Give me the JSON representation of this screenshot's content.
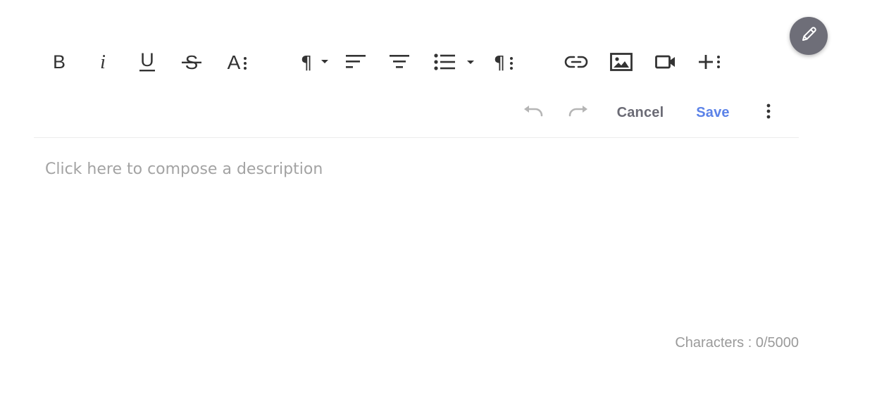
{
  "toolbar": {
    "buttons": [
      {
        "id": "bold",
        "icon": "bold-icon",
        "label": "B"
      },
      {
        "id": "italic",
        "icon": "italic-icon",
        "label": "i"
      },
      {
        "id": "underline",
        "icon": "underline-icon",
        "label": "U"
      },
      {
        "id": "strikethrough",
        "icon": "strikethrough-icon",
        "label": "S"
      },
      {
        "id": "text-style-more",
        "icon": "text-style-more-icon",
        "label": "A"
      },
      {
        "id": "paragraph-format",
        "icon": "paragraph-icon",
        "label": "¶"
      },
      {
        "id": "align-left",
        "icon": "align-left-icon"
      },
      {
        "id": "align-center",
        "icon": "align-center-icon"
      },
      {
        "id": "unordered-list",
        "icon": "bulleted-list-icon"
      },
      {
        "id": "paragraph-more",
        "icon": "paragraph-more-icon",
        "label": "¶"
      },
      {
        "id": "insert-link",
        "icon": "link-icon"
      },
      {
        "id": "insert-image",
        "icon": "image-icon"
      },
      {
        "id": "insert-video",
        "icon": "video-icon"
      },
      {
        "id": "insert-more",
        "icon": "plus-more-icon"
      }
    ]
  },
  "actions": {
    "undo_icon": "undo-icon",
    "redo_icon": "redo-icon",
    "cancel_label": "Cancel",
    "save_label": "Save",
    "more_icon": "more-vertical-icon"
  },
  "editor": {
    "placeholder": "Click here to compose a description",
    "char_counter": "Characters : 0/5000"
  },
  "fab": {
    "icon": "pencil-icon"
  },
  "colors": {
    "icon": "#333333",
    "disabled_icon": "#b5b5b5",
    "save": "#5b82e8",
    "cancel": "#6b6b75",
    "fab": "#6e6e78",
    "placeholder": "#a3a3a3"
  }
}
